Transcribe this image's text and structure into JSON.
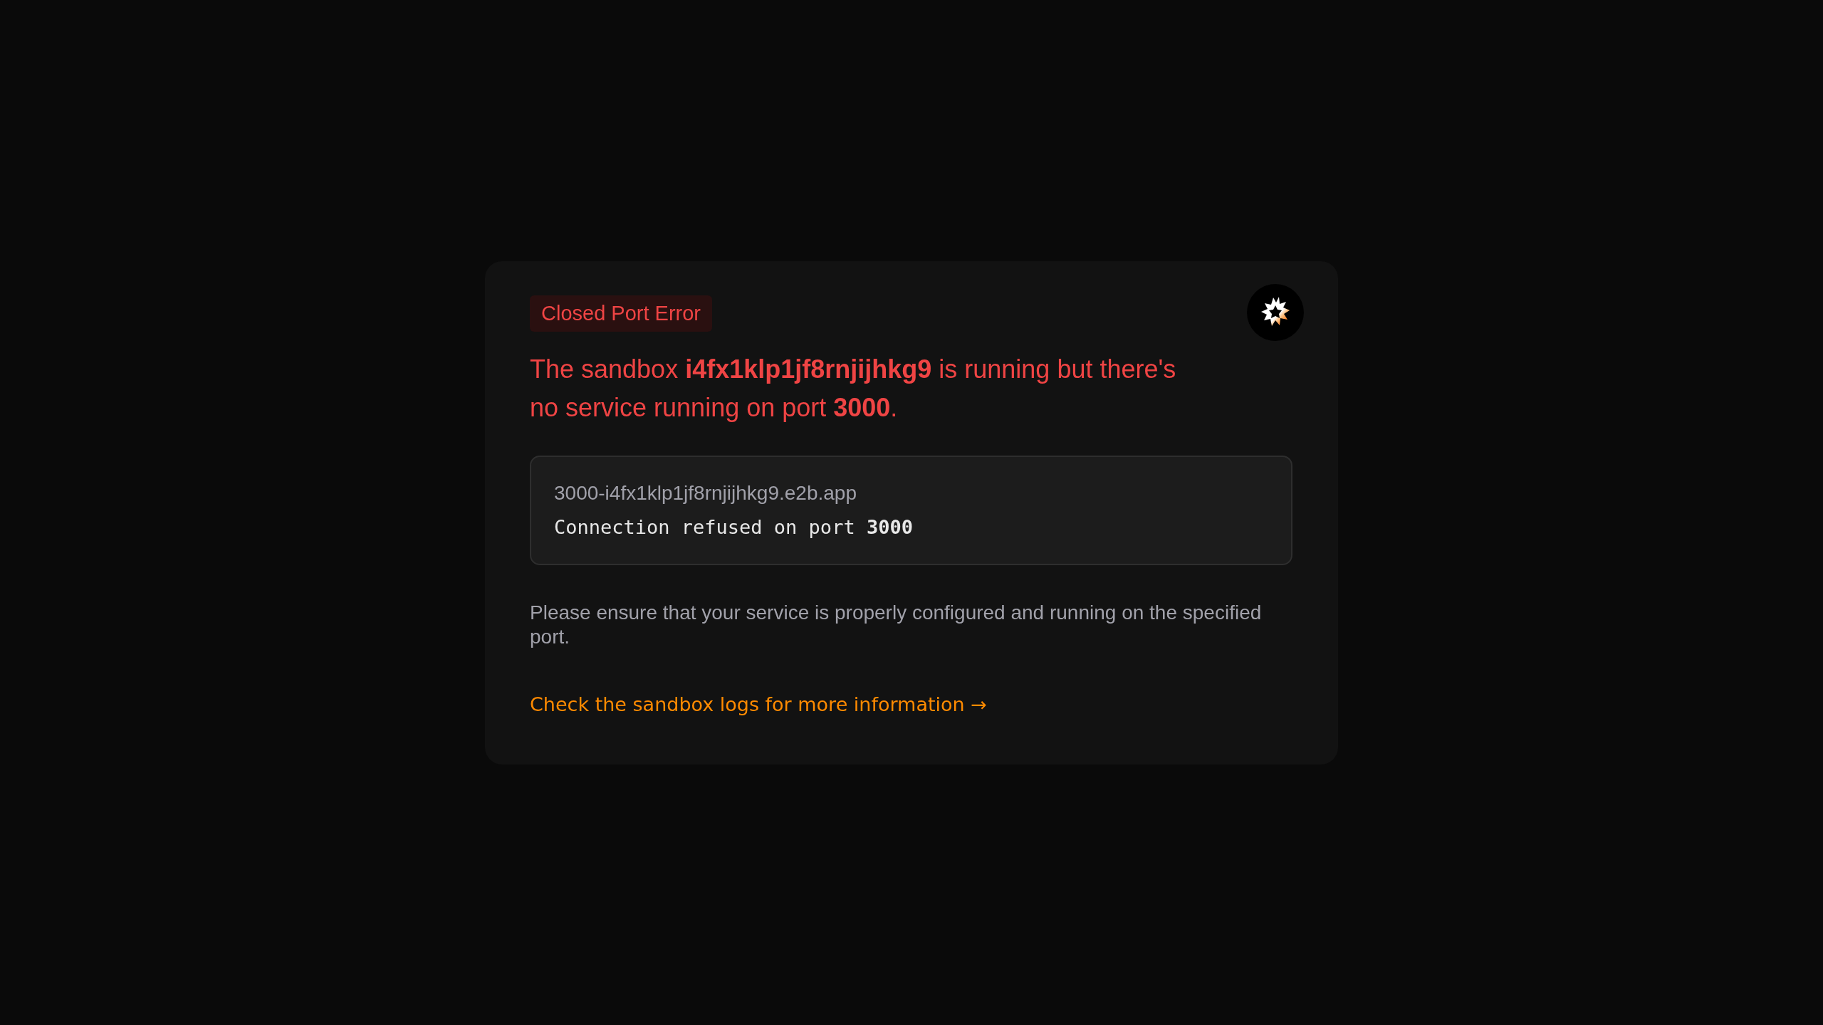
{
  "badge": {
    "label": "Closed Port Error"
  },
  "message": "The sandbox **i4fx1klp1jf8rnjijhkg9** is running but there's no service running on port **3000**.",
  "details": {
    "host": "3000-i4fx1klp1jf8rnjijhkg9.e2b.app",
    "error": "Connection refused on port **3000**"
  },
  "hint": "Please ensure that your service is properly configured and running on the specified port.",
  "link": {
    "label": "Check the sandbox logs for more information →"
  }
}
